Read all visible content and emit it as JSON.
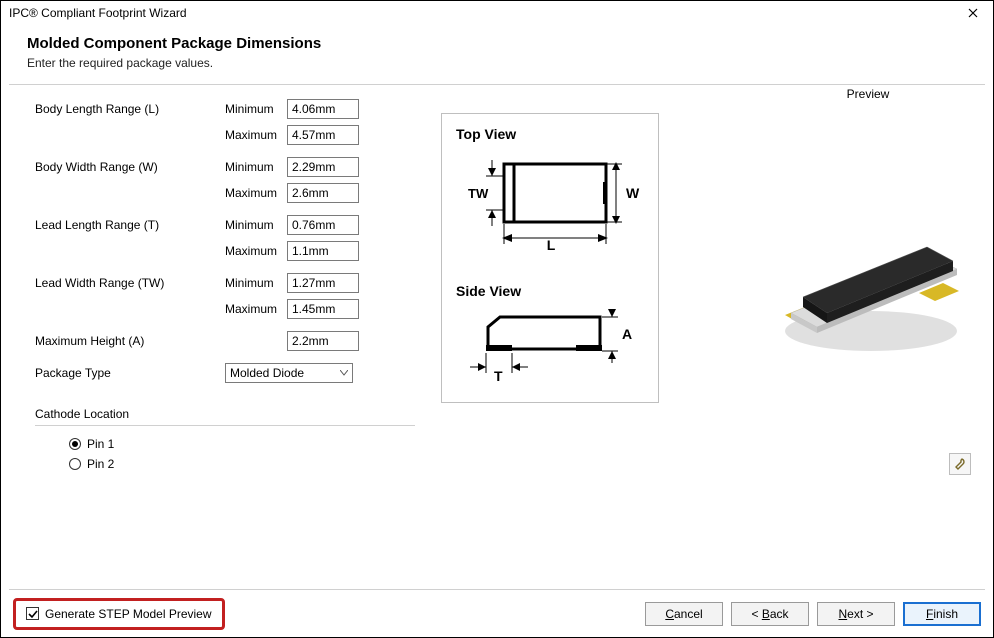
{
  "window": {
    "title": "IPC® Compliant Footprint Wizard"
  },
  "header": {
    "title": "Molded Component Package Dimensions",
    "subtitle": "Enter the required package values."
  },
  "form": {
    "min_label": "Minimum",
    "max_label": "Maximum",
    "body_length": {
      "label": "Body Length Range (L)",
      "min": "4.06mm",
      "max": "4.57mm"
    },
    "body_width": {
      "label": "Body Width Range (W)",
      "min": "2.29mm",
      "max": "2.6mm"
    },
    "lead_length": {
      "label": "Lead Length Range (T)",
      "min": "0.76mm",
      "max": "1.1mm"
    },
    "lead_width": {
      "label": "Lead Width Range (TW)",
      "min": "1.27mm",
      "max": "1.45mm"
    },
    "max_height": {
      "label": "Maximum Height (A)",
      "value": "2.2mm"
    },
    "package_type": {
      "label": "Package Type",
      "value": "Molded Diode"
    },
    "cathode": {
      "label": "Cathode Location",
      "options": [
        "Pin 1",
        "Pin 2"
      ],
      "selected": "Pin 1"
    }
  },
  "diagram": {
    "top_title": "Top View",
    "side_title": "Side View",
    "L": "L",
    "W": "W",
    "TW": "TW",
    "T": "T",
    "A": "A"
  },
  "preview": {
    "label": "Preview",
    "tool_icon": "wrench-icon"
  },
  "footer": {
    "step_checkbox": "Generate STEP Model Preview",
    "step_checked": true,
    "cancel": "Cancel",
    "back": "< Back",
    "next": "Next >",
    "finish": "Finish"
  }
}
